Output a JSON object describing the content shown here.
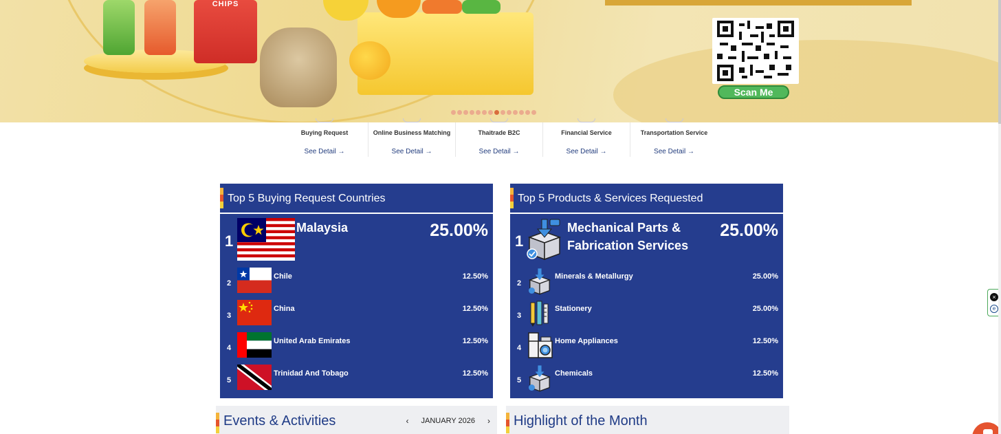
{
  "banner": {
    "chips_label": "CHIPS",
    "qr_label": "Scan Me",
    "slide_count": 14,
    "active_slide": 8
  },
  "services": [
    {
      "title": "Buying Request",
      "link": "See Detail →"
    },
    {
      "title": "Online Business Matching",
      "link": "See Detail →"
    },
    {
      "title": "Thaitrade B2C",
      "link": "See Detail →"
    },
    {
      "title": "Financial Service",
      "link": "See Detail →"
    },
    {
      "title": "Transportation Service",
      "link": "See Detail →"
    }
  ],
  "countries_panel": {
    "title": "Top 5 Buying Request Countries",
    "items": [
      {
        "rank": "1",
        "name": "Malaysia",
        "percent": "25.00%",
        "flag": "malaysia-flag"
      },
      {
        "rank": "2",
        "name": "Chile",
        "percent": "12.50%",
        "flag": "chile-flag"
      },
      {
        "rank": "3",
        "name": "China",
        "percent": "12.50%",
        "flag": "china-flag"
      },
      {
        "rank": "4",
        "name": "United Arab Emirates",
        "percent": "12.50%",
        "flag": "uae-flag"
      },
      {
        "rank": "5",
        "name": "Trinidad And Tobago",
        "percent": "12.50%",
        "flag": "trinidad-flag"
      }
    ]
  },
  "products_panel": {
    "title": "Top 5 Products & Services Requested",
    "items": [
      {
        "rank": "1",
        "name": "Mechanical Parts & Fabrication Services",
        "percent": "25.00%",
        "icon": "box-download-icon"
      },
      {
        "rank": "2",
        "name": "Minerals & Metallurgy",
        "percent": "25.00%",
        "icon": "box-download-icon"
      },
      {
        "rank": "3",
        "name": "Stationery",
        "percent": "25.00%",
        "icon": "stationery-icon"
      },
      {
        "rank": "4",
        "name": "Home Appliances",
        "percent": "12.50%",
        "icon": "appliances-icon"
      },
      {
        "rank": "5",
        "name": "Chemicals",
        "percent": "12.50%",
        "icon": "box-download-icon"
      }
    ]
  },
  "events": {
    "title": "Events & Activities",
    "month": "JANUARY 2026",
    "prev": "‹",
    "next": "›"
  },
  "highlight": {
    "title": "Highlight of the Month"
  },
  "colors": {
    "panel_blue": "#253d8e",
    "link_blue": "#223c7d",
    "accent_orange": "#e5552c",
    "qr_green": "#51b85b"
  }
}
